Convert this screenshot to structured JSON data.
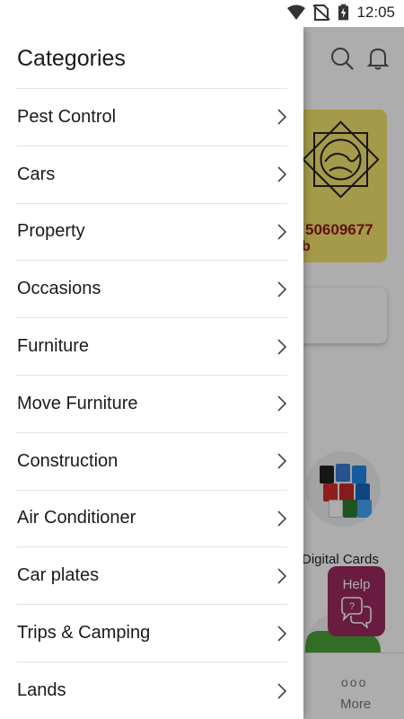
{
  "status_bar": {
    "time": "12:05",
    "icons": [
      "wifi-icon",
      "no-sim-icon",
      "battery-charging-icon"
    ]
  },
  "background": {
    "toolbar_icons": [
      "search-icon",
      "bell-icon"
    ],
    "banner": {
      "phone": "50609677",
      "suffix": "b"
    },
    "category_label": "Digital Cards",
    "help_label": "Help",
    "more_label": "More",
    "more_dots": "ooo"
  },
  "drawer": {
    "title": "Categories",
    "items": [
      {
        "label": "Pest Control"
      },
      {
        "label": "Cars"
      },
      {
        "label": "Property"
      },
      {
        "label": "Occasions"
      },
      {
        "label": "Furniture"
      },
      {
        "label": "Move Furniture"
      },
      {
        "label": "Construction"
      },
      {
        "label": "Air Conditioner"
      },
      {
        "label": "Car plates"
      },
      {
        "label": "Trips & Camping"
      },
      {
        "label": "Lands"
      }
    ]
  },
  "colors": {
    "banner_bg": "#f2e46d",
    "banner_text": "#8b1a1a",
    "help_bg": "#9b2a5e",
    "scrim": "rgba(0,0,0,0.32)"
  }
}
